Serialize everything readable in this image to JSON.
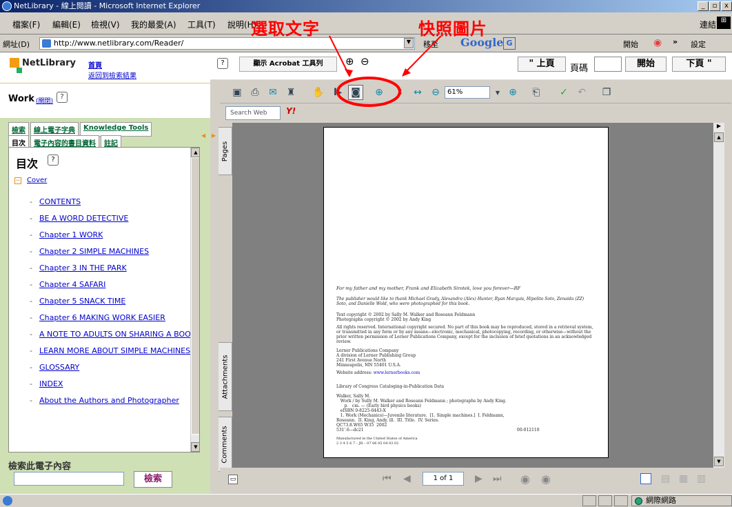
{
  "window": {
    "title": "NetLibrary - 線上閱讀 - Microsoft Internet Explorer"
  },
  "menu": [
    "檔案(F)",
    "編輯(E)",
    "檢視(V)",
    "我的最愛(A)",
    "工具(T)",
    "說明(H)"
  ],
  "links_label": "連結",
  "address": {
    "label": "網址(D)",
    "url": "http://www.netlibrary.com/Reader/",
    "go": "移至"
  },
  "google": {
    "label": "Google",
    "start": "開始",
    "settings": "設定"
  },
  "annotations": {
    "select_text": "選取文字",
    "snapshot": "快照圖片"
  },
  "left": {
    "logo": "NetLibrary",
    "home": "首頁",
    "back_to_results": "返回到檢索結果",
    "book_title": "Work",
    "close": "(關閉)",
    "tabs_top": [
      "檢索",
      "線上電子字典",
      "Knowledge Tools"
    ],
    "tabs_bottom": [
      "目次",
      "電子內容的書目資料",
      "註記"
    ],
    "toc_heading": "目次",
    "toc_root": "Cover",
    "toc_items": [
      "CONTENTS",
      "BE A WORD DETECTIVE",
      "Chapter 1 WORK",
      "Chapter 2 SIMPLE MACHINES",
      "Chapter 3 IN THE PARK",
      "Chapter 4 SAFARI",
      "Chapter 5 SNACK TIME",
      "Chapter 6 MAKING WORK EASIER",
      "A NOTE TO ADULTS ON SHARING A BOOK",
      "LEARN MORE ABOUT SIMPLE MACHINES",
      "GLOSSARY",
      "INDEX",
      "About the Authors and Photographer"
    ],
    "search_heading": "檢索此電子內容",
    "search_button": "檢索"
  },
  "viewer": {
    "show_acrobat": "顯示 Acrobat 工具列",
    "prev_page": "\" 上頁",
    "page_label": "頁碼",
    "go_button": "開始",
    "next_page": "下頁 \"",
    "zoom": "61%",
    "search_placeholder": "Search Web",
    "side_tabs": [
      "Pages",
      "Attachments",
      "Comments"
    ],
    "page_indicator": "1 of 1"
  },
  "pdf": {
    "dedication": "For my father and my mother, Frank and Elizabeth Sirotek, love you forever—RF",
    "thanks": "The publisher would like to thank Michael Grady, Alexandra (Alex) Hunter, Ryan Marquis, Hipolito Soto, Zenaida (ZZ) Soto, and Danielle Wold, who were photographed for this book.",
    "copyright": "Text copyright © 2002 by Sally M. Walker and Roseann Feldmann\nPhotographs copyright © 2002 by Andy King",
    "rights": "All rights reserved. International copyright secured. No part of this book may be reproduced, stored in a retrieval system, or transmitted in any form or by any means—electronic, mechanical, photocopying, recording, or otherwise—without the prior written permission of Lerner Publications Company, except for the inclusion of brief quotations in an acknowledged review.",
    "publisher": "Lerner Publications Company\nA division of Lerner Publishing Group\n241 First Avenue North\nMinneapolis, MN 55401 U.S.A.",
    "website_label": "Website address: ",
    "website": "www.lernerbooks.com",
    "cip_heading": "Library of Congress Cataloging-in-Publication Data",
    "cip": "Walker, Sally M.\n   Work / by Sully M. Walker and Roseann Feldmann ; photographs by Andy King.\n      p.   cm. — (Early bird physics books)\n   eISBN 0-8225-0443-X\n   1. Work (Mechanics)—Juvenile literature.  [1. Simple machines.]  I. Feldmann,\nRoseann.  II. King, Andy, ill.  III. Title.  IV. Series.\nQC73.8.W65 W35  2002\n531'.6—dc21",
    "cip_number": "00-012110",
    "manufactured": "Manufactured in the United States of America\n2 3 4 5 6 7 – JR – 07 06 05 04 03 02"
  },
  "status": {
    "zone": "網際網路"
  }
}
